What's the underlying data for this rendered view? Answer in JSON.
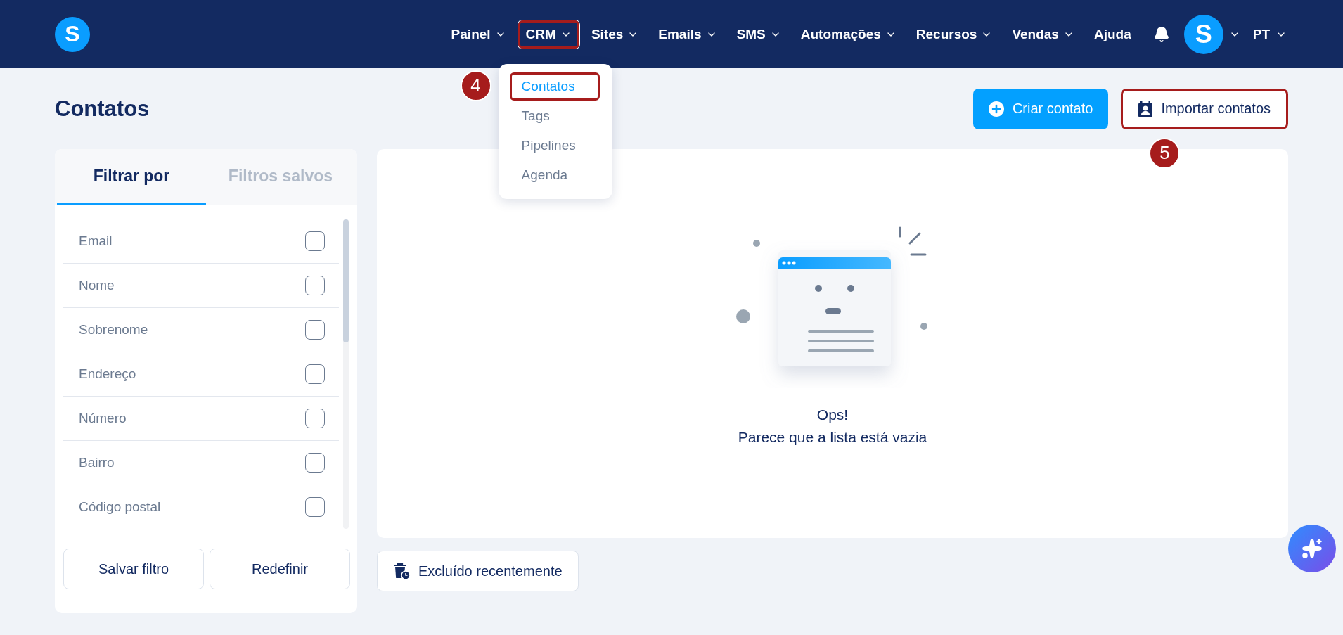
{
  "header": {
    "logo": "S",
    "nav": [
      {
        "label": "Painel",
        "kind": "menu",
        "highlighted": false
      },
      {
        "label": "CRM",
        "kind": "menu",
        "highlighted": true,
        "expanded": true
      },
      {
        "label": "Sites",
        "kind": "menu",
        "highlighted": false
      },
      {
        "label": "Emails",
        "kind": "menu",
        "highlighted": false
      },
      {
        "label": "SMS",
        "kind": "menu",
        "highlighted": false
      },
      {
        "label": "Automações",
        "kind": "menu",
        "highlighted": false
      },
      {
        "label": "Recursos",
        "kind": "menu",
        "highlighted": false
      },
      {
        "label": "Vendas",
        "kind": "menu",
        "highlighted": false
      },
      {
        "label": "Ajuda",
        "kind": "link",
        "highlighted": false
      }
    ],
    "avatar": "S",
    "language": "PT"
  },
  "crm_menu": {
    "items": [
      {
        "label": "Contatos",
        "selected": true,
        "highlighted": true,
        "callout": "4"
      },
      {
        "label": "Tags",
        "selected": false,
        "highlighted": false
      },
      {
        "label": "Pipelines",
        "selected": false,
        "highlighted": false
      },
      {
        "label": "Agenda",
        "selected": false,
        "highlighted": false
      }
    ]
  },
  "page": {
    "title": "Contatos",
    "actions": [
      {
        "kind": "primary",
        "label": "Criar contato",
        "highlighted": false
      },
      {
        "kind": "secondary",
        "label": "Importar contatos",
        "highlighted": true,
        "callout": "5"
      }
    ]
  },
  "filters": {
    "tabs": [
      {
        "label": "Filtrar por",
        "selected": true
      },
      {
        "label": "Filtros salvos",
        "selected": false
      }
    ],
    "fields": [
      {
        "label": "Email",
        "checked": false
      },
      {
        "label": "Nome",
        "checked": false
      },
      {
        "label": "Sobrenome",
        "checked": false
      },
      {
        "label": "Endereço",
        "checked": false
      },
      {
        "label": "Número",
        "checked": false
      },
      {
        "label": "Bairro",
        "checked": false
      },
      {
        "label": "Código postal",
        "checked": false
      }
    ],
    "buttons": [
      "Salvar filtro",
      "Redefinir"
    ]
  },
  "empty_state": {
    "title": "Ops!",
    "message": "Parece que a lista está vazia"
  },
  "recently_deleted": {
    "label": "Excluído recentemente"
  }
}
